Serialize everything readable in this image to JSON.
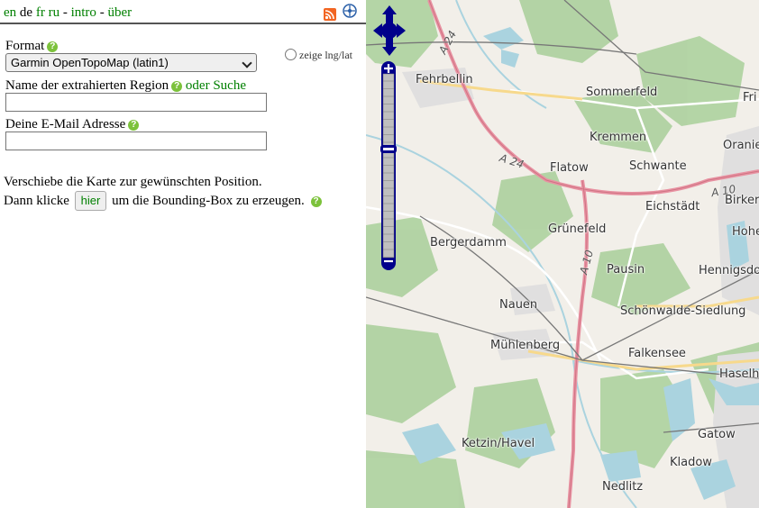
{
  "languages": {
    "en": "en",
    "de": "de",
    "fr": "fr",
    "ru": "ru",
    "sep": "-",
    "intro": "intro",
    "ueber": "über"
  },
  "form": {
    "format_label": "Format",
    "format_value": "Garmin OpenTopoMap (latin1)",
    "lnglat_label": "zeige lng/lat",
    "region_label": "Name der extrahierten Region",
    "search_link": "oder Suche",
    "region_value": "",
    "email_label": "Deine E-Mail Adresse",
    "email_value": ""
  },
  "instructions": {
    "line1": "Verschiebe die Karte zur gewünschten Position.",
    "line2_before": "Dann klicke",
    "hier_button": "hier",
    "line2_after": "um die Bounding-Box zu erzeugen."
  },
  "help_glyph": "?",
  "map": {
    "places": [
      "Fehrbellin",
      "Sommerfeld",
      "Fri",
      "Kremmen",
      "Oranie",
      "Flatow",
      "Schwante",
      "Eichstädt",
      "Birker",
      "Hohe",
      "Grünefeld",
      "Bergerdamm",
      "Pausin",
      "Hennigsdo",
      "Nauen",
      "Schönwalde-Siedlung",
      "Mühlenberg",
      "Falkensee",
      "Haselho",
      "Gatow",
      "Ketzin/Havel",
      "Kladow",
      "Nedlitz"
    ],
    "roads": [
      "A 24",
      "A 24",
      "A 10",
      "A 10"
    ],
    "colors": {
      "forest": "#add19e",
      "water": "#aad3df",
      "motorway": "#e892a2",
      "land": "#f2efe9",
      "control": "#00008b"
    }
  }
}
